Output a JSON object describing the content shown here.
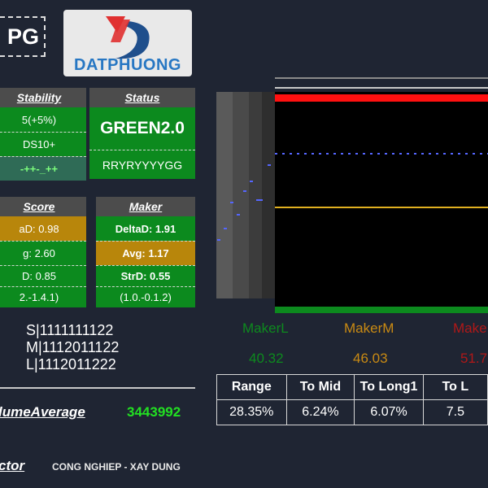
{
  "ticker": "PG",
  "logo": {
    "text": "DATPHUONG"
  },
  "stability": {
    "title": "Stability",
    "rows": [
      "5(+5%)",
      "DS10+",
      "-++-_++"
    ]
  },
  "status": {
    "title": "Status",
    "main": "GREEN2.0",
    "sub": "RRYRYYYYGG"
  },
  "score": {
    "title": "Score",
    "rows": [
      "aD: 0.98",
      "g: 2.60",
      "D: 0.85",
      "2.-1.4.1)"
    ]
  },
  "maker": {
    "title": "Maker",
    "rows": [
      "DeltaD: 1.91",
      "Avg: 1.17",
      "StrD: 0.55",
      "(1.0.-0.1.2)"
    ]
  },
  "sequences": [
    "S|1111111122",
    "M|1112011122",
    "L|1112011222"
  ],
  "volume": {
    "label": "lumeAverage",
    "value": "3443992"
  },
  "sector": {
    "label": "ctor",
    "value": "CONG NGHIEP - XAY DUNG"
  },
  "makers": [
    {
      "label": "MakerL",
      "value": "40.32",
      "color": "#0d8a1e"
    },
    {
      "label": "MakerM",
      "value": "46.03",
      "color": "#c98a13"
    },
    {
      "label": "Make",
      "value": "51.7",
      "color": "#b01818"
    }
  ],
  "table": {
    "headers": [
      "Range",
      "To Mid",
      "To Long1",
      "To L"
    ],
    "values": [
      "28.35%",
      "6.24%",
      "6.07%",
      "7.5"
    ]
  },
  "colors": {
    "green": "#0c8a1e",
    "gold": "#b8860b",
    "red": "#ff1010",
    "dotted_blue": "#5566ff",
    "yellow_line": "#e0b020"
  }
}
